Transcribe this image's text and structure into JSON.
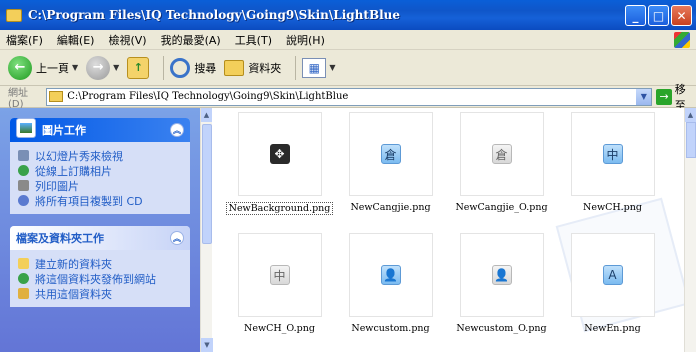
{
  "window": {
    "title": "C:\\Program Files\\IQ Technology\\Going9\\Skin\\LightBlue"
  },
  "menu": [
    "檔案(F)",
    "編輯(E)",
    "檢視(V)",
    "我的最愛(A)",
    "工具(T)",
    "說明(H)"
  ],
  "toolbar": {
    "back_label": "上一頁",
    "search_label": "搜尋",
    "folders_label": "資料夾"
  },
  "address": {
    "label": "網址(D)",
    "path": "C:\\Program Files\\IQ Technology\\Going9\\Skin\\LightBlue",
    "go_label": "移至"
  },
  "picture_tasks": {
    "title": "圖片工作",
    "items": [
      "以幻燈片秀來檢視",
      "從線上訂購相片",
      "列印圖片",
      "將所有項目複製到 CD"
    ]
  },
  "file_tasks": {
    "title": "檔案及資料夾工作",
    "items": [
      "建立新的資料夾",
      "將這個資料夾發佈到網站",
      "共用這個資料夾"
    ]
  },
  "files": [
    {
      "name": "NewBackground.png",
      "glyph": "✥",
      "style": "dark",
      "selected": true
    },
    {
      "name": "NewCangjie.png",
      "glyph": "倉",
      "style": "blue"
    },
    {
      "name": "NewCangjie_O.png",
      "glyph": "倉",
      "style": "gray"
    },
    {
      "name": "NewCH.png",
      "glyph": "中",
      "style": "blue"
    },
    {
      "name": "NewCH_O.png",
      "glyph": "中",
      "style": "gray"
    },
    {
      "name": "Newcustom.png",
      "glyph": "👤",
      "style": "blue"
    },
    {
      "name": "Newcustom_O.png",
      "glyph": "👤",
      "style": "gray"
    },
    {
      "name": "NewEn.png",
      "glyph": "A",
      "style": "blue"
    }
  ]
}
